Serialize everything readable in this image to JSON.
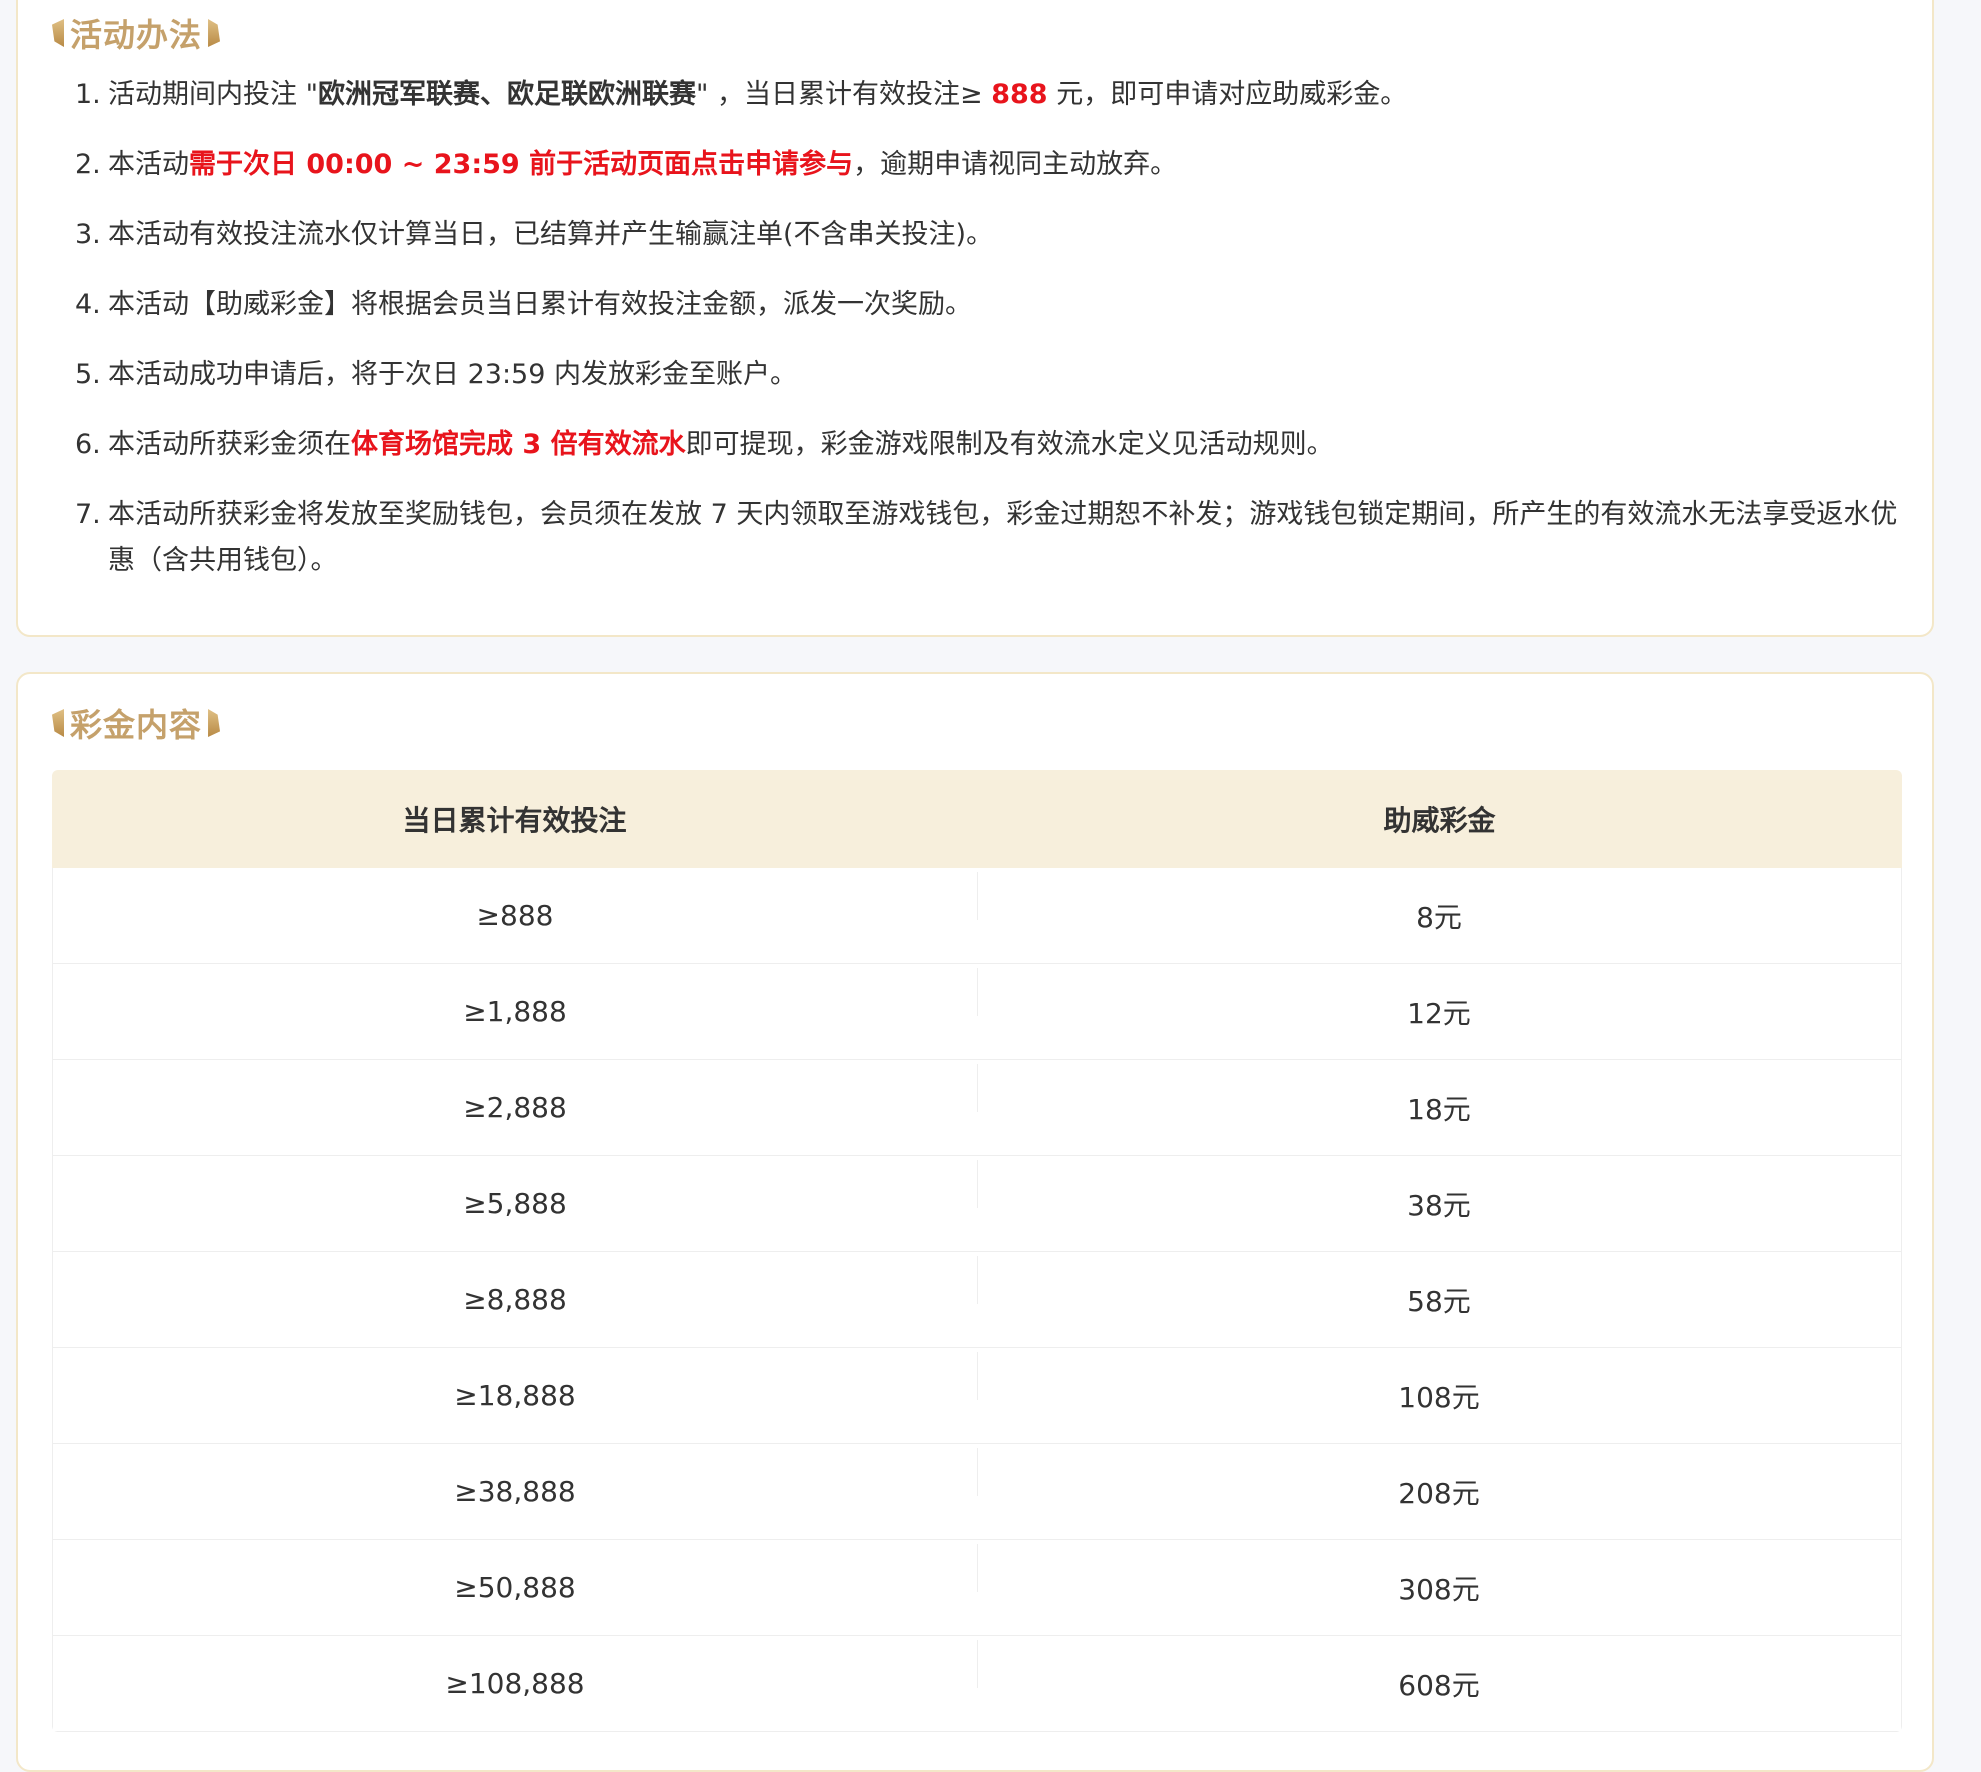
{
  "rules_section": {
    "title": "活动办法",
    "items": [
      {
        "num": "1.",
        "parts": [
          {
            "text": "活动期间内投注 \"",
            "style": "normal"
          },
          {
            "text": "欧洲冠军联赛、欧足联欧洲联赛",
            "style": "bold"
          },
          {
            "text": "\" ，当日累计有效投注≥ ",
            "style": "normal"
          },
          {
            "text": "888",
            "style": "red"
          },
          {
            "text": " 元，即可申请对应助威彩金。",
            "style": "normal"
          }
        ]
      },
      {
        "num": "2.",
        "parts": [
          {
            "text": "本活动",
            "style": "normal"
          },
          {
            "text": "需于次日 00:00 ~ 23:59 前于活动页面点击申请参与",
            "style": "red"
          },
          {
            "text": "，逾期申请视同主动放弃。",
            "style": "normal"
          }
        ]
      },
      {
        "num": "3.",
        "parts": [
          {
            "text": "本活动有效投注流水仅计算当日，已结算并产生输赢注单(不含串关投注)。",
            "style": "normal"
          }
        ]
      },
      {
        "num": "4.",
        "parts": [
          {
            "text": "本活动【助威彩金】将根据会员当日累计有效投注金额，派发一次奖励。",
            "style": "normal"
          }
        ]
      },
      {
        "num": "5.",
        "parts": [
          {
            "text": "本活动成功申请后，将于次日 23:59 内发放彩金至账户。",
            "style": "normal"
          }
        ]
      },
      {
        "num": "6.",
        "parts": [
          {
            "text": "本活动所获彩金须在",
            "style": "normal"
          },
          {
            "text": "体育场馆完成 3 倍有效流水",
            "style": "red"
          },
          {
            "text": "即可提现，彩金游戏限制及有效流水定义见活动规则。",
            "style": "normal"
          }
        ]
      },
      {
        "num": "7.",
        "parts": [
          {
            "text": "本活动所获彩金将发放至奖励钱包，会员须在发放 7 天内领取至游戏钱包，彩金过期恕不补发；游戏钱包锁定期间，所产生的有效流水无法享受返水优惠（含共用钱包）。",
            "style": "normal"
          }
        ]
      }
    ]
  },
  "bonus_section": {
    "title": "彩金内容",
    "columns": [
      "当日累计有效投注",
      "助威彩金"
    ],
    "rows": [
      [
        "≥888",
        "8元"
      ],
      [
        "≥1,888",
        "12元"
      ],
      [
        "≥2,888",
        "18元"
      ],
      [
        "≥5,888",
        "38元"
      ],
      [
        "≥8,888",
        "58元"
      ],
      [
        "≥18,888",
        "108元"
      ],
      [
        "≥38,888",
        "208元"
      ],
      [
        "≥50,888",
        "308元"
      ],
      [
        "≥108,888",
        "608元"
      ]
    ]
  },
  "colors": {
    "title_gold": "#c5a16b",
    "emphasis_red": "#e8141c",
    "table_header_bg": "#f7efdc",
    "card_border": "#f3e7c8"
  }
}
